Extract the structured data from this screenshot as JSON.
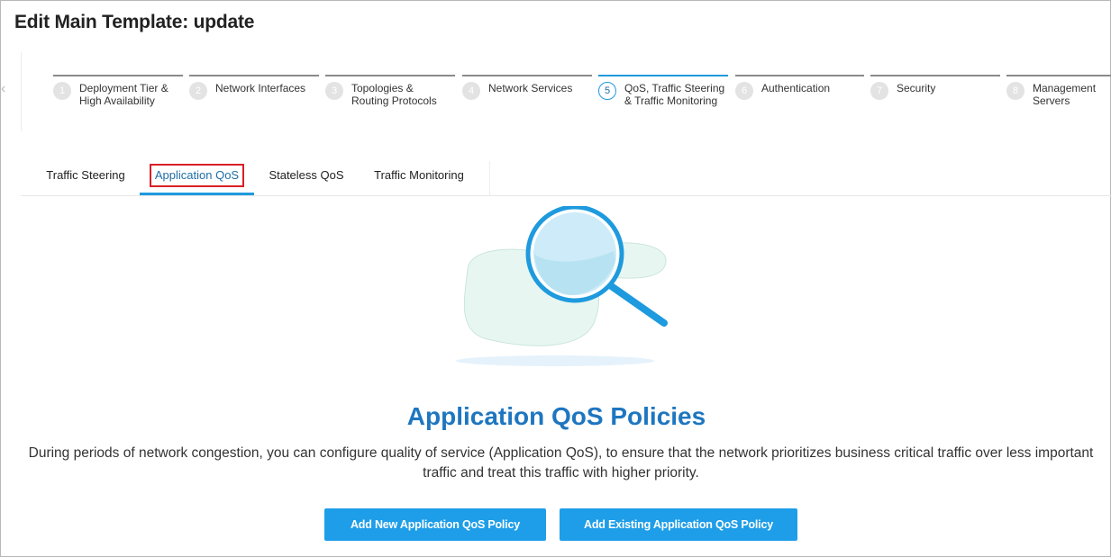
{
  "page": {
    "title": "Edit Main Template: update"
  },
  "stepper": {
    "steps": [
      {
        "number": "1",
        "label": "Deployment Tier &\nHigh Availability",
        "active": false
      },
      {
        "number": "2",
        "label": "Network Interfaces",
        "active": false
      },
      {
        "number": "3",
        "label": "Topologies &\nRouting Protocols",
        "active": false
      },
      {
        "number": "4",
        "label": "Network Services",
        "active": false
      },
      {
        "number": "5",
        "label": "QoS, Traffic Steering\n& Traffic Monitoring",
        "active": true
      },
      {
        "number": "6",
        "label": "Authentication",
        "active": false
      },
      {
        "number": "7",
        "label": "Security",
        "active": false
      },
      {
        "number": "8",
        "label": "Management\nServers",
        "active": false
      }
    ]
  },
  "tabs": {
    "items": [
      {
        "label": "Traffic Steering",
        "active": false
      },
      {
        "label": "Application QoS",
        "active": true
      },
      {
        "label": "Stateless QoS",
        "active": false
      },
      {
        "label": "Traffic Monitoring",
        "active": false
      }
    ]
  },
  "empty_state": {
    "illustration_icon": "magnifier-icon",
    "heading": "Application QoS Policies",
    "description": "During periods of network congestion, you can configure quality of service (Application QoS), to ensure that the network prioritizes business critical traffic over less important traffic and treat this traffic with higher priority.",
    "add_new_label": "Add New Application QoS Policy",
    "add_existing_label": "Add Existing Application QoS Policy"
  },
  "colors": {
    "accent": "#1e9ade",
    "heading_blue": "#1e76c0",
    "button_blue": "#1e9ee8",
    "highlight_red": "#d92027"
  }
}
